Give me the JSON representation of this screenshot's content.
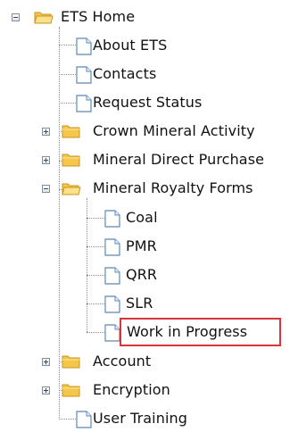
{
  "tree": {
    "root": {
      "label": "ETS Home",
      "icon": "folder-open-icon",
      "expanded": true
    },
    "items": [
      {
        "label": "About ETS",
        "icon": "document-icon"
      },
      {
        "label": "Contacts",
        "icon": "document-icon"
      },
      {
        "label": "Request Status",
        "icon": "document-icon"
      },
      {
        "label": "Crown Mineral Activity",
        "icon": "folder-icon",
        "expanded": false
      },
      {
        "label": "Mineral Direct Purchase",
        "icon": "folder-icon",
        "expanded": false
      },
      {
        "label": "Mineral Royalty Forms",
        "icon": "folder-open-icon",
        "expanded": true,
        "children": [
          {
            "label": "Coal",
            "icon": "document-icon"
          },
          {
            "label": "PMR",
            "icon": "document-icon"
          },
          {
            "label": "QRR",
            "icon": "document-icon"
          },
          {
            "label": "SLR",
            "icon": "document-icon"
          },
          {
            "label": "Work in Progress",
            "icon": "document-icon",
            "highlighted": true
          }
        ]
      },
      {
        "label": "Account",
        "icon": "folder-icon",
        "expanded": false
      },
      {
        "label": "Encryption",
        "icon": "folder-icon",
        "expanded": false
      },
      {
        "label": "User Training",
        "icon": "document-icon"
      }
    ]
  },
  "colors": {
    "highlight_border": "#d9333b",
    "folder": "#f4c64a",
    "document_border": "#5b88b8",
    "tree_lines": "#8a8a8a"
  }
}
